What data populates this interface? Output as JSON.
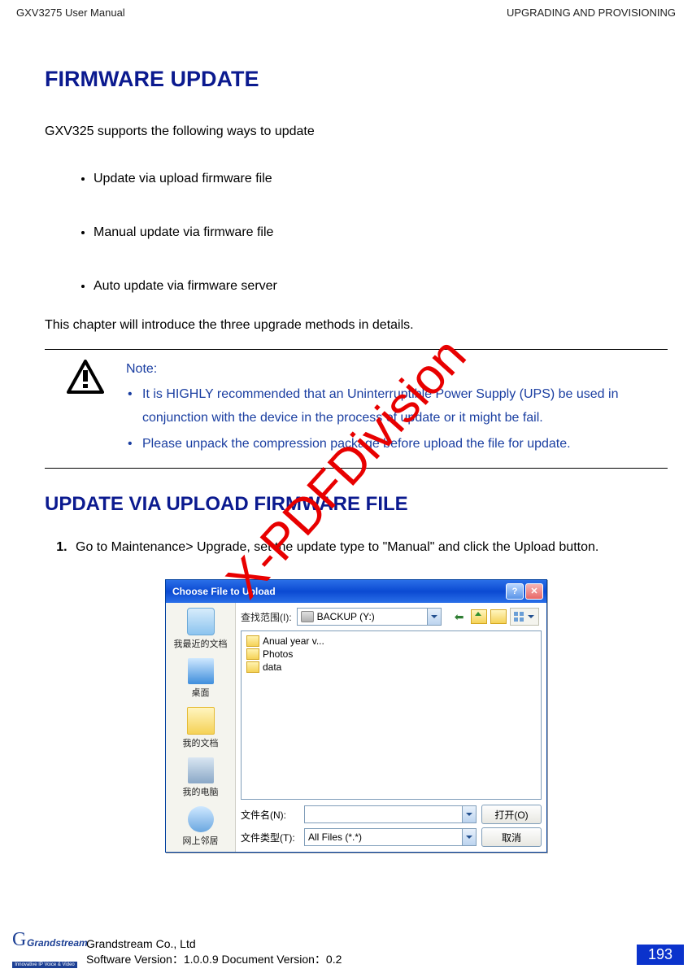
{
  "header": {
    "left": "GXV3275 User Manual",
    "right": "UPGRADING AND PROVISIONING"
  },
  "h1": "FIRMWARE UPDATE",
  "intro": "GXV325 supports the following ways to update",
  "bullets": [
    "Update via upload firmware file",
    "Manual update via firmware file",
    "Auto update via firmware server"
  ],
  "after_bullets": "This chapter will introduce the three upgrade methods in details.",
  "note": {
    "title": "Note:",
    "items": [
      "It is HIGHLY recommended that an Uninterruptible Power Supply (UPS) be used in conjunction with the device in the process of update or it might be fail.",
      "Please unpack the compression package before upload the file for update."
    ]
  },
  "h2": "UPDATE VIA UPLOAD FIRMWARE FILE",
  "step1": "Go to Maintenance> Upgrade, set the update type to \"Manual\" and click the Upload button.",
  "dialog": {
    "title": "Choose File to Upload",
    "lookin_label": "查找范围(I):",
    "lookin_value": "BACKUP (Y:)",
    "places": [
      "我最近的文档",
      "桌面",
      "我的文档",
      "我的电脑",
      "网上邻居"
    ],
    "files": [
      "Anual year v...",
      "Photos",
      "data"
    ],
    "filename_label": "文件名(N):",
    "filename_value": "",
    "filetype_label": "文件类型(T):",
    "filetype_value": "All Files (*.*)",
    "open_btn": "打开(O)",
    "cancel_btn": "取消"
  },
  "watermark": "X-PDFDivision",
  "footer": {
    "logo_brand": "Grandstream",
    "logo_band": "Innovative IP Voice & Video",
    "company": "Grandstream Co., Ltd",
    "version": "Software Version：1.0.0.9 Document Version：0.2",
    "page": "193"
  }
}
